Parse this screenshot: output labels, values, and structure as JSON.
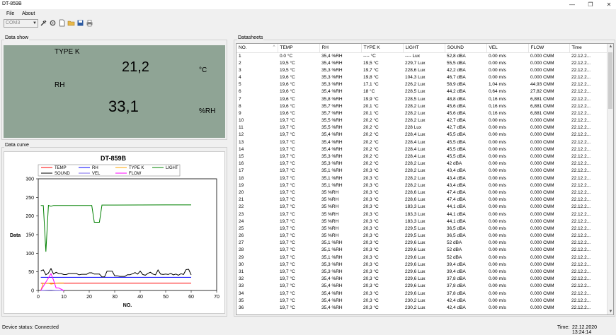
{
  "window": {
    "title": "DT-859B",
    "minimize": "—",
    "maximize": "❐",
    "close": "✕"
  },
  "menu": {
    "file": "File",
    "about": "About"
  },
  "toolbar": {
    "port": "COM3",
    "icons": [
      "connect-icon",
      "settings-icon",
      "new-file-icon",
      "open-folder-icon",
      "save-icon",
      "print-icon"
    ]
  },
  "data_show": {
    "group_label": "Data show",
    "type_label": "TYPE K",
    "type_value": "21,2",
    "type_unit": "°C",
    "rh_label": "RH",
    "rh_value": "33,1",
    "rh_unit": "%RH",
    "bg_color": "#8fa495"
  },
  "data_curve": {
    "group_label": "Data curve"
  },
  "chart_data": {
    "type": "line",
    "title": "DT-859B",
    "xlabel": "NO.",
    "ylabel": "Data",
    "xlim": [
      0,
      70
    ],
    "ylim": [
      0,
      300
    ],
    "xticks": [
      0,
      10,
      20,
      30,
      40,
      50,
      60,
      70
    ],
    "yticks": [
      0,
      50,
      100,
      150,
      200,
      250,
      300
    ],
    "legend": "top",
    "series": [
      {
        "name": "TEMP",
        "color": "#ff0000",
        "x": [
          1,
          60
        ],
        "y": [
          19.6,
          19.7
        ]
      },
      {
        "name": "RH",
        "color": "#0000ff",
        "x": [
          1,
          60
        ],
        "y": [
          35.4,
          35.4
        ]
      },
      {
        "name": "TYPE K",
        "color": "#ffa500",
        "x": [
          1,
          2,
          3,
          4,
          5,
          6,
          7,
          8,
          9,
          10
        ],
        "y": [
          0,
          19.7,
          19.8,
          20.0,
          17.1,
          18.0,
          19.9,
          20.1,
          20.1,
          20.2
        ]
      },
      {
        "name": "LIGHT",
        "color": "#008000",
        "x": [
          1,
          2,
          3,
          4,
          5,
          6,
          8,
          10,
          15,
          20,
          21,
          22,
          23,
          24,
          25,
          30,
          40,
          50,
          60
        ],
        "y": [
          228.5,
          228,
          104.3,
          228.6,
          226.2,
          228.5,
          228.2,
          228.2,
          228.4,
          228.2,
          228.2,
          183.3,
          183.3,
          183.3,
          229.5,
          229.6,
          229.8,
          229.9,
          229.9
        ]
      },
      {
        "name": "SOUND",
        "color": "#000000",
        "x": [
          1,
          2,
          3,
          4,
          5,
          6,
          7,
          8,
          9,
          10,
          11,
          12,
          13,
          14,
          15,
          16,
          17,
          18,
          19,
          20,
          21,
          22,
          23,
          24,
          25,
          26,
          27,
          28,
          29,
          30,
          31,
          32,
          33,
          34,
          35,
          36,
          37,
          38,
          39,
          40,
          41,
          42,
          43,
          44,
          45,
          46,
          47,
          48,
          49,
          50,
          51,
          52,
          53,
          54,
          55,
          56,
          57,
          58,
          59,
          60
        ],
        "y": [
          52.8,
          55.5,
          42.2,
          46.7,
          58.9,
          44.2,
          48.8,
          45.6,
          45.6,
          42.7,
          42.7,
          45.5,
          45.5,
          45.5,
          45.5,
          42,
          43.4,
          43.4,
          43.4,
          47.4,
          47.4,
          44.1,
          44.1,
          44.1,
          36.5,
          36.5,
          52,
          52,
          52,
          39.4,
          39.4,
          37.8,
          37.8,
          37.8,
          42.4,
          42.4,
          45,
          48,
          44,
          52,
          43,
          41,
          46,
          49,
          44,
          42,
          55,
          44,
          43,
          44,
          43,
          46,
          42,
          44,
          41,
          45,
          43,
          56,
          57,
          42
        ]
      },
      {
        "name": "VEL",
        "color": "#7b68ee",
        "x": [
          1,
          5,
          6,
          7,
          8,
          10
        ],
        "y": [
          0,
          1.04,
          0.64,
          0.16,
          0.16,
          0
        ]
      },
      {
        "name": "FLOW",
        "color": "#ff00ff",
        "x": [
          1,
          5,
          6,
          7,
          8,
          10
        ],
        "y": [
          0,
          44.93,
          27.82,
          6.881,
          6.881,
          0
        ]
      }
    ]
  },
  "datasheets": {
    "group_label": "Datasheets",
    "sort_indicator": "^",
    "columns": [
      "NO.",
      "TEMP",
      "RH",
      "TYPE K",
      "LIGHT",
      "SOUND",
      "VEL",
      "FLOW",
      "Time"
    ],
    "rows": [
      [
        "1",
        "0.0 °C",
        "35,4 %RH",
        "---- °C",
        "---- Lux",
        "52,8 dBA",
        "0.00 m/s",
        "0.000 CMM",
        "22.12.2..."
      ],
      [
        "2",
        "19,5 °C",
        "35,4 %RH",
        "19,5 °C",
        "229,7 Lux",
        "55,5 dBA",
        "0.00 m/s",
        "0.000 CMM",
        "22.12.2..."
      ],
      [
        "3",
        "19,5 °C",
        "35,3 %RH",
        "19,7 °C",
        "228,6 Lux",
        "42,2 dBA",
        "0.00 m/s",
        "0.000 CMM",
        "22.12.2..."
      ],
      [
        "4",
        "19,6 °C",
        "35,3 %RH",
        "19,8 °C",
        "104,3 Lux",
        "46,7 dBA",
        "0.00 m/s",
        "0.000 CMM",
        "22.12.2..."
      ],
      [
        "5",
        "19,6 °C",
        "35,3 %RH",
        "17,1 °C",
        "226,2 Lux",
        "58,9 dBA",
        "1,04 m/s",
        "44,93 CMM",
        "22.12.2..."
      ],
      [
        "6",
        "19,6 °C",
        "35,4 %RH",
        "18 °C",
        "228,5 Lux",
        "44,2 dBA",
        "0,64 m/s",
        "27,82 CMM",
        "22.12.2..."
      ],
      [
        "7",
        "19,6 °C",
        "35,8 %RH",
        "19,9 °C",
        "228,5 Lux",
        "48,8 dBA",
        "0,16 m/s",
        "6,881 CMM",
        "22.12.2..."
      ],
      [
        "8",
        "19,6 °C",
        "35,7 %RH",
        "20,1 °C",
        "228,2 Lux",
        "45,6 dBA",
        "0,16 m/s",
        "6,881 CMM",
        "22.12.2..."
      ],
      [
        "9",
        "19,6 °C",
        "35,7 %RH",
        "20,1 °C",
        "228,2 Lux",
        "45,6 dBA",
        "0,16 m/s",
        "6,881 CMM",
        "22.12.2..."
      ],
      [
        "10",
        "19,7 °C",
        "35,5 %RH",
        "20,2 °C",
        "228,2 Lux",
        "42,7 dBA",
        "0.00 m/s",
        "0.000 CMM",
        "22.12.2..."
      ],
      [
        "11",
        "19,7 °C",
        "35,5 %RH",
        "20,2 °C",
        "228 Lux",
        "42,7 dBA",
        "0.00 m/s",
        "0.000 CMM",
        "22.12.2..."
      ],
      [
        "12",
        "19,7 °C",
        "35,4 %RH",
        "20,2 °C",
        "228,4 Lux",
        "45,5 dBA",
        "0.00 m/s",
        "0.000 CMM",
        "22.12.2..."
      ],
      [
        "13",
        "19,7 °C",
        "35,4 %RH",
        "20,2 °C",
        "228,4 Lux",
        "45,5 dBA",
        "0.00 m/s",
        "0.000 CMM",
        "22.12.2..."
      ],
      [
        "14",
        "19,7 °C",
        "35,4 %RH",
        "20,2 °C",
        "228,4 Lux",
        "45,5 dBA",
        "0.00 m/s",
        "0.000 CMM",
        "22.12.2..."
      ],
      [
        "15",
        "19,7 °C",
        "35,3 %RH",
        "20,2 °C",
        "228,4 Lux",
        "45,5 dBA",
        "0.00 m/s",
        "0.000 CMM",
        "22.12.2..."
      ],
      [
        "16",
        "19,7 °C",
        "35,3 %RH",
        "20,2 °C",
        "228,2 Lux",
        "42 dBA",
        "0.00 m/s",
        "0.000 CMM",
        "22.12.2..."
      ],
      [
        "17",
        "19,7 °C",
        "35,1 %RH",
        "20,3 °C",
        "228,2 Lux",
        "43,4 dBA",
        "0.00 m/s",
        "0.000 CMM",
        "22.12.2..."
      ],
      [
        "18",
        "19,7 °C",
        "35,1 %RH",
        "20,3 °C",
        "228,2 Lux",
        "43,4 dBA",
        "0.00 m/s",
        "0.000 CMM",
        "22.12.2..."
      ],
      [
        "19",
        "19,7 °C",
        "35,1 %RH",
        "20,3 °C",
        "228,2 Lux",
        "43,4 dBA",
        "0.00 m/s",
        "0.000 CMM",
        "22.12.2..."
      ],
      [
        "20",
        "19,7 °C",
        "35 %RH",
        "20,3 °C",
        "228,6 Lux",
        "47,4 dBA",
        "0.00 m/s",
        "0.000 CMM",
        "22.12.2..."
      ],
      [
        "21",
        "19,7 °C",
        "35 %RH",
        "20,3 °C",
        "228,6 Lux",
        "47,4 dBA",
        "0.00 m/s",
        "0.000 CMM",
        "22.12.2..."
      ],
      [
        "22",
        "19,7 °C",
        "35 %RH",
        "20,3 °C",
        "183,3 Lux",
        "44,1 dBA",
        "0.00 m/s",
        "0.000 CMM",
        "22.12.2..."
      ],
      [
        "23",
        "19,7 °C",
        "35 %RH",
        "20,3 °C",
        "183,3 Lux",
        "44,1 dBA",
        "0.00 m/s",
        "0.000 CMM",
        "22.12.2..."
      ],
      [
        "24",
        "19,7 °C",
        "35 %RH",
        "20,3 °C",
        "183,3 Lux",
        "44,1 dBA",
        "0.00 m/s",
        "0.000 CMM",
        "22.12.2..."
      ],
      [
        "25",
        "19,7 °C",
        "35 %RH",
        "20,3 °C",
        "229,5 Lux",
        "36,5 dBA",
        "0.00 m/s",
        "0.000 CMM",
        "22.12.2..."
      ],
      [
        "26",
        "19,7 °C",
        "35 %RH",
        "20,3 °C",
        "229,5 Lux",
        "36,5 dBA",
        "0.00 m/s",
        "0.000 CMM",
        "22.12.2..."
      ],
      [
        "27",
        "19,7 °C",
        "35,1 %RH",
        "20,3 °C",
        "229,6 Lux",
        "52 dBA",
        "0.00 m/s",
        "0.000 CMM",
        "22.12.2..."
      ],
      [
        "28",
        "19,7 °C",
        "35,1 %RH",
        "20,3 °C",
        "229,6 Lux",
        "52 dBA",
        "0.00 m/s",
        "0.000 CMM",
        "22.12.2..."
      ],
      [
        "29",
        "19,7 °C",
        "35,1 %RH",
        "20,3 °C",
        "229,6 Lux",
        "52 dBA",
        "0.00 m/s",
        "0.000 CMM",
        "22.12.2..."
      ],
      [
        "30",
        "19,7 °C",
        "35,3 %RH",
        "20,3 °C",
        "229,6 Lux",
        "39,4 dBA",
        "0.00 m/s",
        "0.000 CMM",
        "22.12.2..."
      ],
      [
        "31",
        "19,7 °C",
        "35,3 %RH",
        "20,3 °C",
        "229,6 Lux",
        "39,4 dBA",
        "0.00 m/s",
        "0.000 CMM",
        "22.12.2..."
      ],
      [
        "32",
        "19,7 °C",
        "35,4 %RH",
        "20,3 °C",
        "229,6 Lux",
        "37,8 dBA",
        "0.00 m/s",
        "0.000 CMM",
        "22.12.2..."
      ],
      [
        "33",
        "19,7 °C",
        "35,4 %RH",
        "20,3 °C",
        "229,6 Lux",
        "37,8 dBA",
        "0.00 m/s",
        "0.000 CMM",
        "22.12.2..."
      ],
      [
        "34",
        "19,7 °C",
        "35,4 %RH",
        "20,3 °C",
        "229,6 Lux",
        "37,8 dBA",
        "0.00 m/s",
        "0.000 CMM",
        "22.12.2..."
      ],
      [
        "35",
        "19,7 °C",
        "35,4 %RH",
        "20,3 °C",
        "230,2 Lux",
        "42,4 dBA",
        "0.00 m/s",
        "0.000 CMM",
        "22.12.2..."
      ],
      [
        "36",
        "19,7 °C",
        "35,4 %RH",
        "20,3 °C",
        "230,2 Lux",
        "42,4 dBA",
        "0.00 m/s",
        "0.000 CMM",
        "22.12.2..."
      ]
    ]
  },
  "status": {
    "device_label": "Device status:",
    "device_value": "Connected",
    "time_label": "Time:",
    "time_value": "22.12.2020 13:24:14"
  }
}
